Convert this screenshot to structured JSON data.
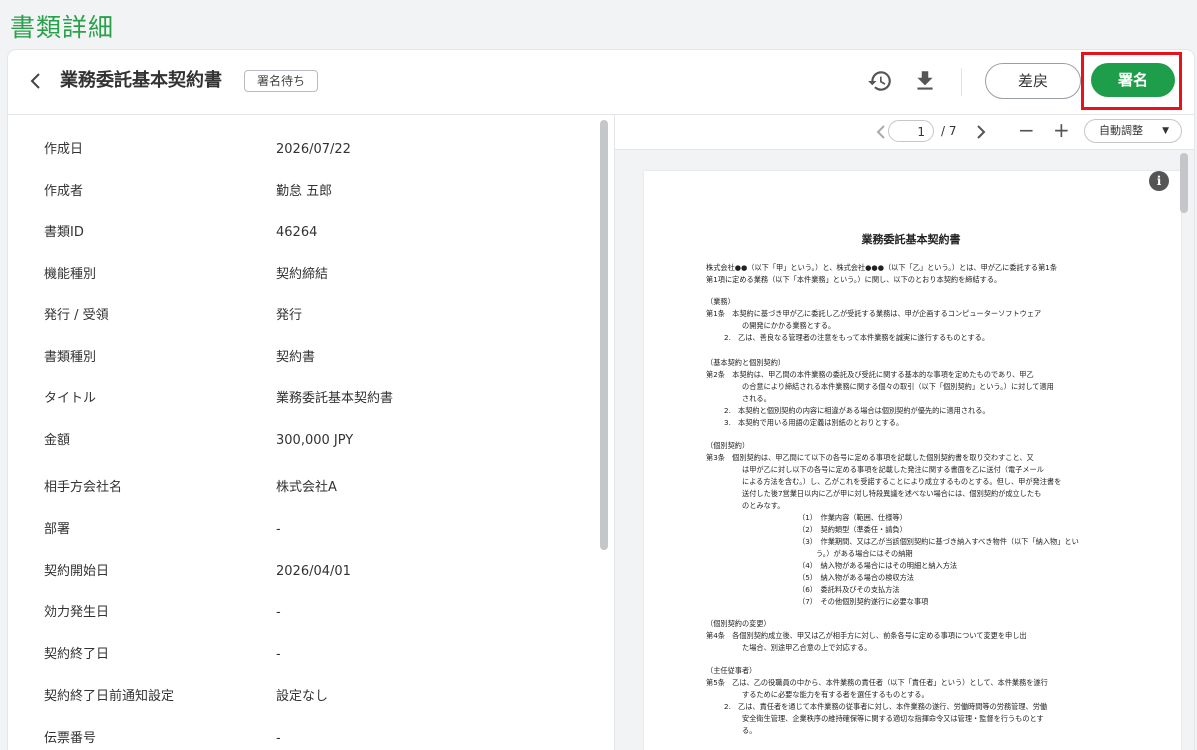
{
  "page_title": "書類詳細",
  "header": {
    "back_icon": "chevron-left-icon",
    "document_title": "業務委託基本契約書",
    "status_badge": "署名待ち",
    "history_icon": "history-icon",
    "download_icon": "download-icon",
    "return_label": "差戻",
    "sign_label": "署名",
    "sign_color": "#1e9e4a",
    "highlight_color": "#e8131a"
  },
  "details": [
    {
      "label": "作成日",
      "value": "2026/07/22"
    },
    {
      "label": "作成者",
      "value": "勤怠 五郎"
    },
    {
      "label": "書類ID",
      "value": "46264"
    },
    {
      "label": "機能種別",
      "value": "契約締結"
    },
    {
      "label": "発行 / 受領",
      "value": "発行"
    },
    {
      "label": "書類種別",
      "value": "契約書"
    },
    {
      "label": "タイトル",
      "value": "業務委託基本契約書"
    },
    {
      "label": "金額",
      "value": "300,000 JPY"
    },
    {
      "label": "相手方会社名",
      "value": "株式会社A"
    },
    {
      "label": "部署",
      "value": "-"
    },
    {
      "label": "契約開始日",
      "value": "2026/04/01"
    },
    {
      "label": "効力発生日",
      "value": "-"
    },
    {
      "label": "契約終了日",
      "value": "-"
    },
    {
      "label": "契約終了日前通知設定",
      "value": "設定なし"
    },
    {
      "label": "伝票番号",
      "value": "-"
    }
  ],
  "viewer": {
    "prev_icon": "chevron-left-icon",
    "next_icon": "chevron-right-icon",
    "current_page": "1",
    "total_pages": "/ 7",
    "zoom_out": "−",
    "zoom_in": "+",
    "zoom_mode": "自動調整",
    "info_icon": "info-icon"
  },
  "pdf": {
    "title": "業務委託基本契約書",
    "lines": [
      "株式会社●●（以下「甲」という。）と、株式会社●●●（以下「乙」という。）とは、甲が乙に委託する第1条",
      "第1項に定める業務（以下「本件業務」という。）に関し、以下のとおり本契約を締結する。",
      "（業務）",
      "第1条　本契約に基づき甲が乙に委託し乙が受託する業務は、甲が企画するコンピューターソフトウェア",
      "の開発にかかる業務とする。",
      "2.　乙は、善良なる管理者の注意をもって本件業務を誠実に遂行するものとする。",
      "（基本契約と個別契約）",
      "第2条　本契約は、甲乙間の本件業務の委託及び受託に関する基本的な事項を定めたものであり、甲乙",
      "の合意により締結される本件業務に関する個々の取引（以下「個別契約」という。）に対して適用",
      "される。",
      "2.　本契約と個別契約の内容に相違がある場合は個別契約が優先的に適用される。",
      "3.　本契約で用いる用語の定義は別紙のとおりとする。",
      "（個別契約）",
      "第3条　個別契約は、甲乙間にて以下の各号に定める事項を記載した個別契約書を取り交わすこと、又",
      "は甲が乙に対し以下の各号に定める事項を記載した発注に関する書面を乙に送付（電子メール",
      "による方法を含む。）し、乙がこれを受諾することにより成立するものとする。但し、甲が発注書を",
      "送付した後7営業日以内に乙が甲に対し特段異議を述べない場合には、個別契約が成立したも",
      "のとみなす。",
      "（1）　作業内容（範囲、仕様等）",
      "（2）　契約類型（準委任・請負）",
      "（3）　作業期間、又は乙が当該個別契約に基づき納入すべき物件（以下「納入物」とい",
      "う。）がある場合にはその納期",
      "（4）　納入物がある場合にはその明細と納入方法",
      "（5）　納入物がある場合の検収方法",
      "（6）　委託料及びその支払方法",
      "（7）　その他個別契約遂行に必要な事項",
      "（個別契約の変更）",
      "第4条　各個別契約成立後、甲又は乙が相手方に対し、前条各号に定める事項について変更を申し出",
      "た場合、別途甲乙合意の上で対応する。",
      "（主任従事者）",
      "第5条　乙は、乙の役職員の中から、本件業務の責任者（以下「責任者」という）として、本件業務を遂行",
      "するために必要な能力を有する者を選任するものとする。",
      "2.　乙は、責任者を通じて本件業務の従事者に対し、本件業務の遂行、労働時間等の労務管理、労働",
      "安全衛生管理、企業秩序の維持確保等に関する適切な指揮命令又は管理・監督を行うものとす",
      "る。"
    ]
  }
}
